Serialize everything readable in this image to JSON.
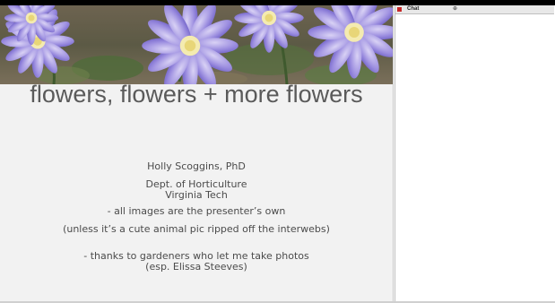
{
  "slide": {
    "title": "flowers, flowers + more flowers",
    "presenter": "Holly Scoggins, PhD",
    "department": "Dept. of Horticulture",
    "institution": "Virginia Tech",
    "note1": "- all images are the presenter’s own",
    "note2": "(unless it’s a cute animal pic ripped off the interwebs)",
    "note3": "- thanks to gardeners who let me take photos",
    "note4": "(esp. Elissa Steeves)"
  },
  "chat_panel": {
    "title": "Chat",
    "header_glyph": "⊕"
  },
  "colors": {
    "flower_petal": "#8a7ad8",
    "flower_center": "#f2e49a",
    "slide_background": "#f2f2f2"
  }
}
